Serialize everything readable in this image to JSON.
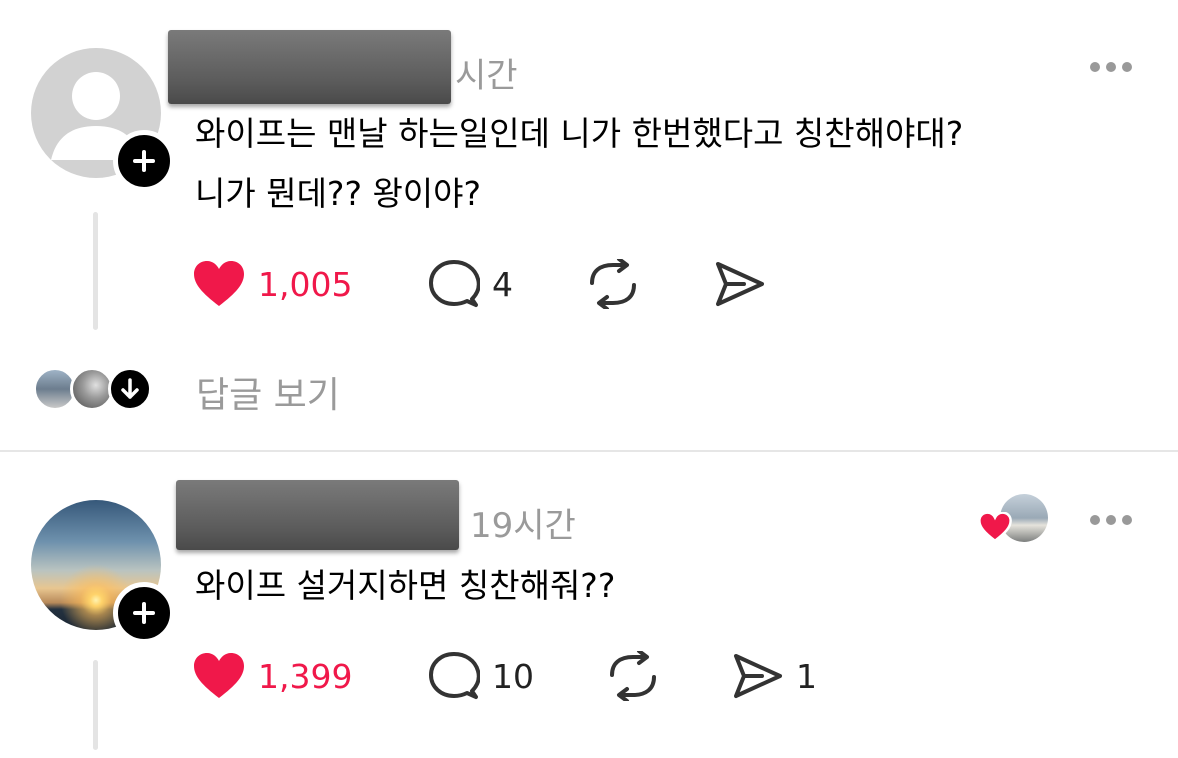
{
  "colors": {
    "like": "#f0184a",
    "meta": "#9a9a9a",
    "text": "#000000"
  },
  "posts": [
    {
      "time": "시간",
      "text_lines": [
        "와이프는 맨날 하는일인데 니가 한번했다고 칭찬해야대?",
        "니가 뭔데?? 왕이야?"
      ],
      "likes": "1,005",
      "comments": "4",
      "reposts": "",
      "shares": "",
      "replies_label": "답글 보기"
    },
    {
      "time": "19시간",
      "text_lines": [
        "와이프 설거지하면 칭찬해줘??"
      ],
      "likes": "1,399",
      "comments": "10",
      "reposts": "",
      "shares": "1"
    }
  ],
  "icons": {
    "like": "heart-icon",
    "comment": "comment-icon",
    "repost": "repost-icon",
    "share": "share-icon",
    "more": "more-icon",
    "follow": "plus-icon",
    "replies": "arrow-down-icon"
  }
}
